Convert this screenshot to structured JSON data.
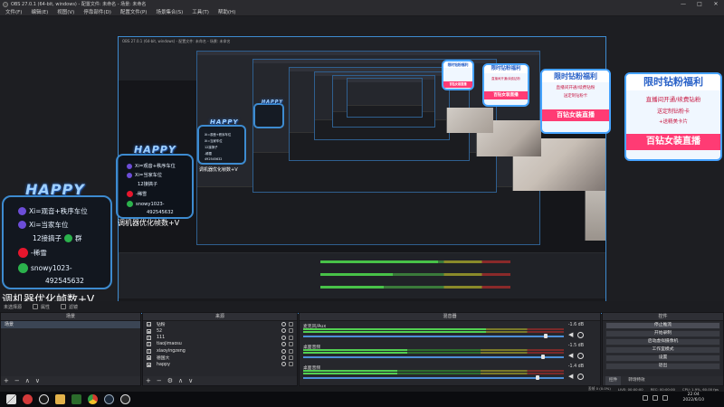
{
  "window": {
    "title": "OBS 27.0.1 (64-bit, windows) - 配置文件: 未命名 - 场景: 未命名",
    "buttons": [
      "—",
      "□",
      "✕"
    ]
  },
  "menu": [
    "文件(F)",
    "编辑(E)",
    "视图(V)",
    "停靠部件(D)",
    "配置文件(P)",
    "场景集合(S)",
    "工具(T)",
    "帮助(H)"
  ],
  "overlay": {
    "happy_word": "HAPPY",
    "caption": "调机器优化帧数+V",
    "card_lines": [
      "Xi=观音+秩序车位",
      "Xi=当家车位",
      "12接搞子",
      "-稀雪",
      "snowy1023-",
      "492545632"
    ],
    "qq_suffix": "群",
    "promo": {
      "head": "限时钻粉福利",
      "mid": "直播间开通/续费钻粉",
      "mid2": "送定制钻粉卡",
      "mid3": "+送精美卡片",
      "foot": "百钻女装直播"
    }
  },
  "status_strip": {
    "source_name": "未选择源",
    "properties": "属性",
    "filters": "滤镜"
  },
  "docks": {
    "scenes": {
      "title": "场景",
      "items": [
        "场景"
      ]
    },
    "sources": {
      "title": "来源",
      "items": [
        {
          "icon": "display-capture",
          "name": "钻粉"
        },
        {
          "icon": "image",
          "name": "52"
        },
        {
          "icon": "text",
          "name": "111"
        },
        {
          "icon": "text",
          "name": "tiaojimaosu"
        },
        {
          "icon": "text",
          "name": "xiaoyingzeng"
        },
        {
          "icon": "image",
          "name": "德国大"
        },
        {
          "icon": "image",
          "name": "happy"
        }
      ]
    },
    "mixer": {
      "title": "混音器",
      "tracks": [
        {
          "name": "麦克风/Aux",
          "db": "-1.6 dB",
          "level": 0.7,
          "volume": 0.93
        },
        {
          "name": "桌面音频",
          "db": "-1.5 dB",
          "level": 0.4,
          "volume": 0.92
        },
        {
          "name": "桌面音频",
          "db": "-1.4 dB",
          "level": 0.36,
          "volume": 0.9
        }
      ]
    },
    "controls": {
      "title": "控件",
      "buttons": [
        "停止推流",
        "开始录制",
        "启动虚拟摄像机",
        "工作室模式",
        "设置",
        "退出"
      ],
      "tabs": [
        "控件",
        "转场特效"
      ]
    }
  },
  "statusbar": {
    "dropped": "丢帧 0 (0.0%)",
    "live": "LIVE: 00:00:00",
    "rec": "REC: 00:00:00",
    "cpu": "CPU: 1.9%, 60.00 fps"
  },
  "taskbar": {
    "time": "22:04",
    "date": "2022/6/10",
    "icons": [
      "windows-logo",
      "netease-music",
      "obs",
      "folder",
      "steam-ish",
      "chrome",
      "steam",
      "obs"
    ]
  },
  "colors": {
    "accent_blue": "#3d8bd0",
    "promo_pink": "#ff3b74",
    "meter_green": "#52d052"
  }
}
